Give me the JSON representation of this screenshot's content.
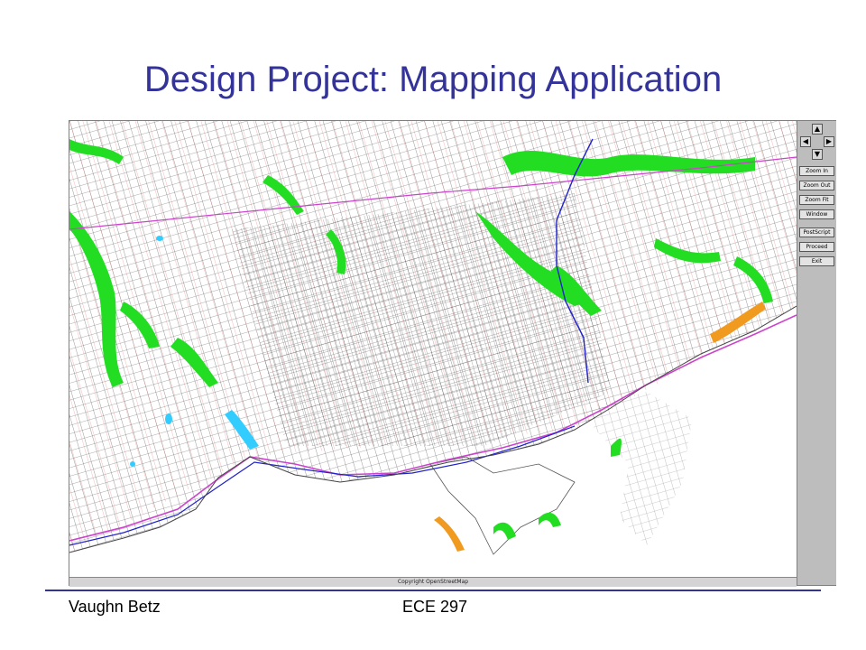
{
  "slide": {
    "title": "Design Project: Mapping Application",
    "author": "Vaughn Betz",
    "course": "ECE 297"
  },
  "map": {
    "copyright": "Copyright OpenStreetMap"
  },
  "controls": {
    "arrows": {
      "up": "▲",
      "down": "▼",
      "left": "◀",
      "right": "▶"
    },
    "buttons": {
      "zoom_in": "Zoom In",
      "zoom_out": "Zoom Out",
      "zoom_fit": "Zoom Fit",
      "window": "Window",
      "postscript": "PostScript",
      "proceed": "Proceed",
      "exit": "Exit"
    }
  },
  "colors": {
    "title": "#333399",
    "park": "#22dd22",
    "water": "#33ccff",
    "sand": "#f09a20",
    "road_major": "#2222cc",
    "road_red": "#e06060",
    "rail": "#cc44cc"
  }
}
